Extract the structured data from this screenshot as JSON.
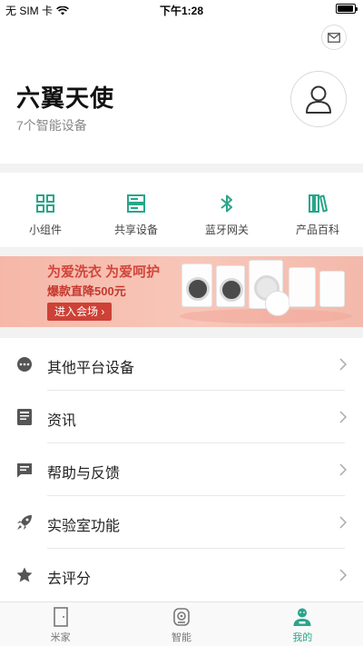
{
  "status_bar": {
    "carrier": "无 SIM 卡",
    "time": "下午1:28",
    "battery_level": 0.95
  },
  "profile": {
    "name": "六翼天使",
    "device_count": "7个智能设备"
  },
  "shortcuts": [
    {
      "label": "小组件",
      "icon": "widget-icon"
    },
    {
      "label": "共享设备",
      "icon": "share-device-icon"
    },
    {
      "label": "蓝牙网关",
      "icon": "bluetooth-icon"
    },
    {
      "label": "产品百科",
      "icon": "books-icon"
    }
  ],
  "banner": {
    "title": "为爱洗衣 为爱呵护",
    "subtitle": "爆款直降500元",
    "button": "进入会场 ›"
  },
  "menu": [
    {
      "label": "其他平台设备",
      "icon": "more-dots-icon"
    },
    {
      "label": "资讯",
      "icon": "news-icon"
    },
    {
      "label": "帮助与反馈",
      "icon": "feedback-icon"
    },
    {
      "label": "实验室功能",
      "icon": "rocket-icon"
    },
    {
      "label": "去评分",
      "icon": "star-icon"
    }
  ],
  "tabbar": [
    {
      "label": "米家",
      "icon": "door-icon",
      "active": false
    },
    {
      "label": "智能",
      "icon": "robot-icon",
      "active": false
    },
    {
      "label": "我的",
      "icon": "profile-icon",
      "active": true
    }
  ],
  "colors": {
    "accent": "#2aa58b",
    "banner_red": "#cd4136",
    "separator": "#f2f2f2"
  }
}
